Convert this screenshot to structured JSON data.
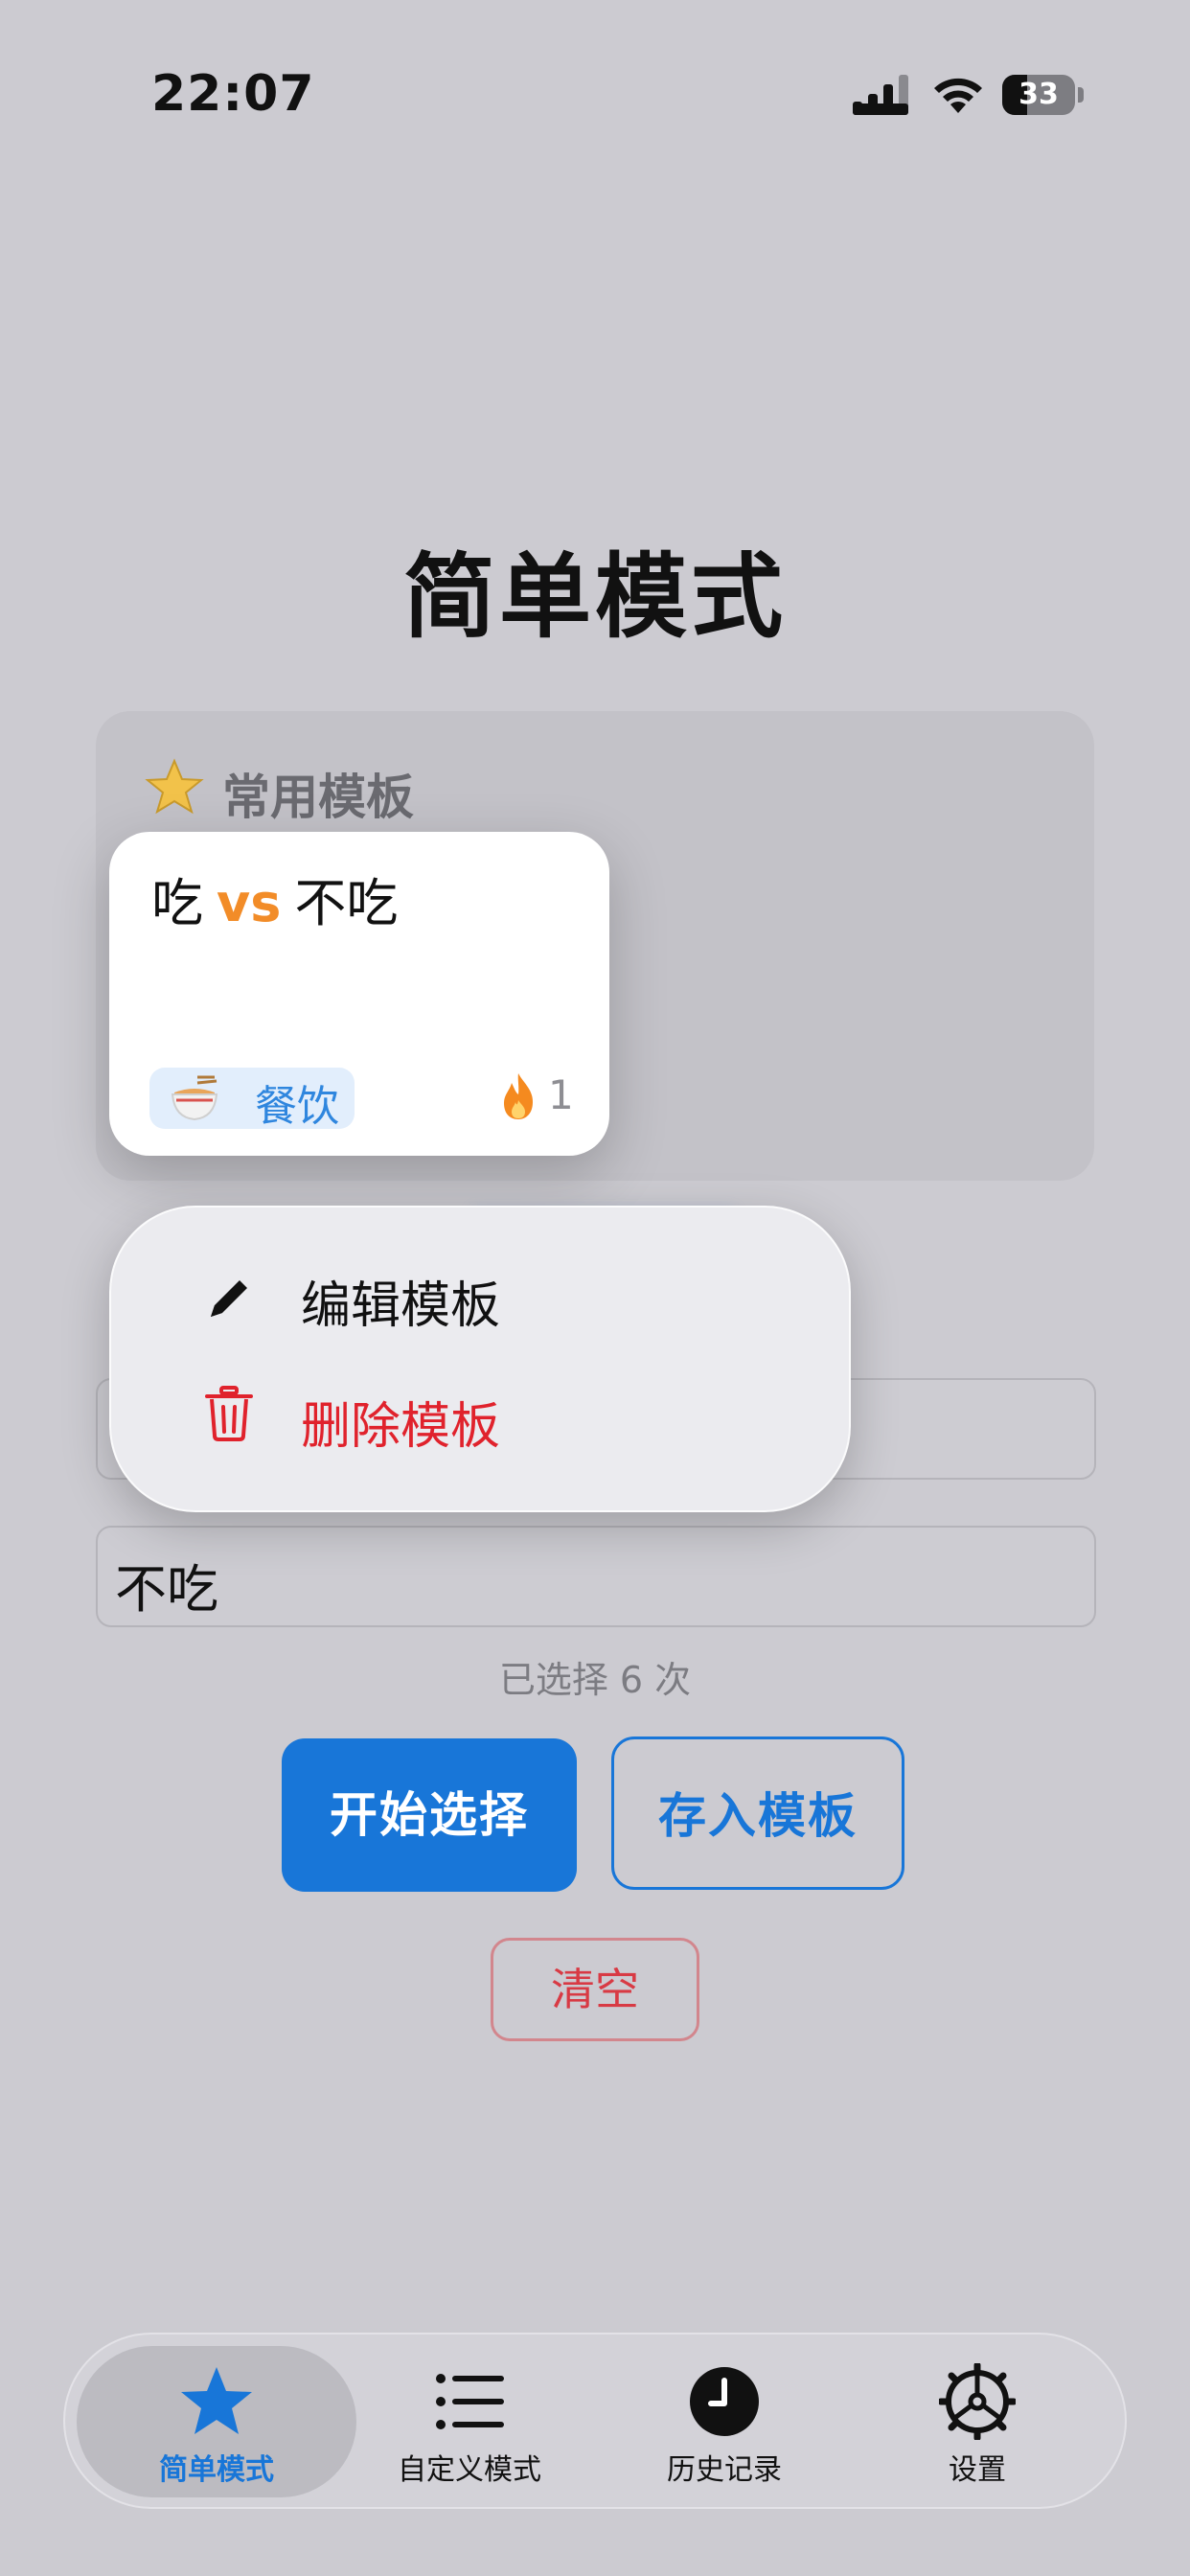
{
  "status_bar": {
    "time": "22:07",
    "battery": "33"
  },
  "page": {
    "title": "简单模式"
  },
  "templates": {
    "heading": "常用模板",
    "card": {
      "title_left": "吃",
      "vs": "vs",
      "title_right": "不吃",
      "category": "餐饮",
      "use_count": "1"
    }
  },
  "context_menu": {
    "edit_label": "编辑模板",
    "delete_label": "删除模板"
  },
  "form": {
    "option2_value": "不吃",
    "selected_count_text": "已选择 6 次"
  },
  "actions": {
    "start_label": "开始选择",
    "save_label": "存入模板",
    "clear_label": "清空"
  },
  "tab_bar": {
    "simple": "简单模式",
    "custom": "自定义模式",
    "history": "历史记录",
    "settings": "设置"
  },
  "colors": {
    "accent": "#1876d8",
    "danger": "#e0222c",
    "vs": "#f28c28",
    "background": "#cccbd1"
  }
}
